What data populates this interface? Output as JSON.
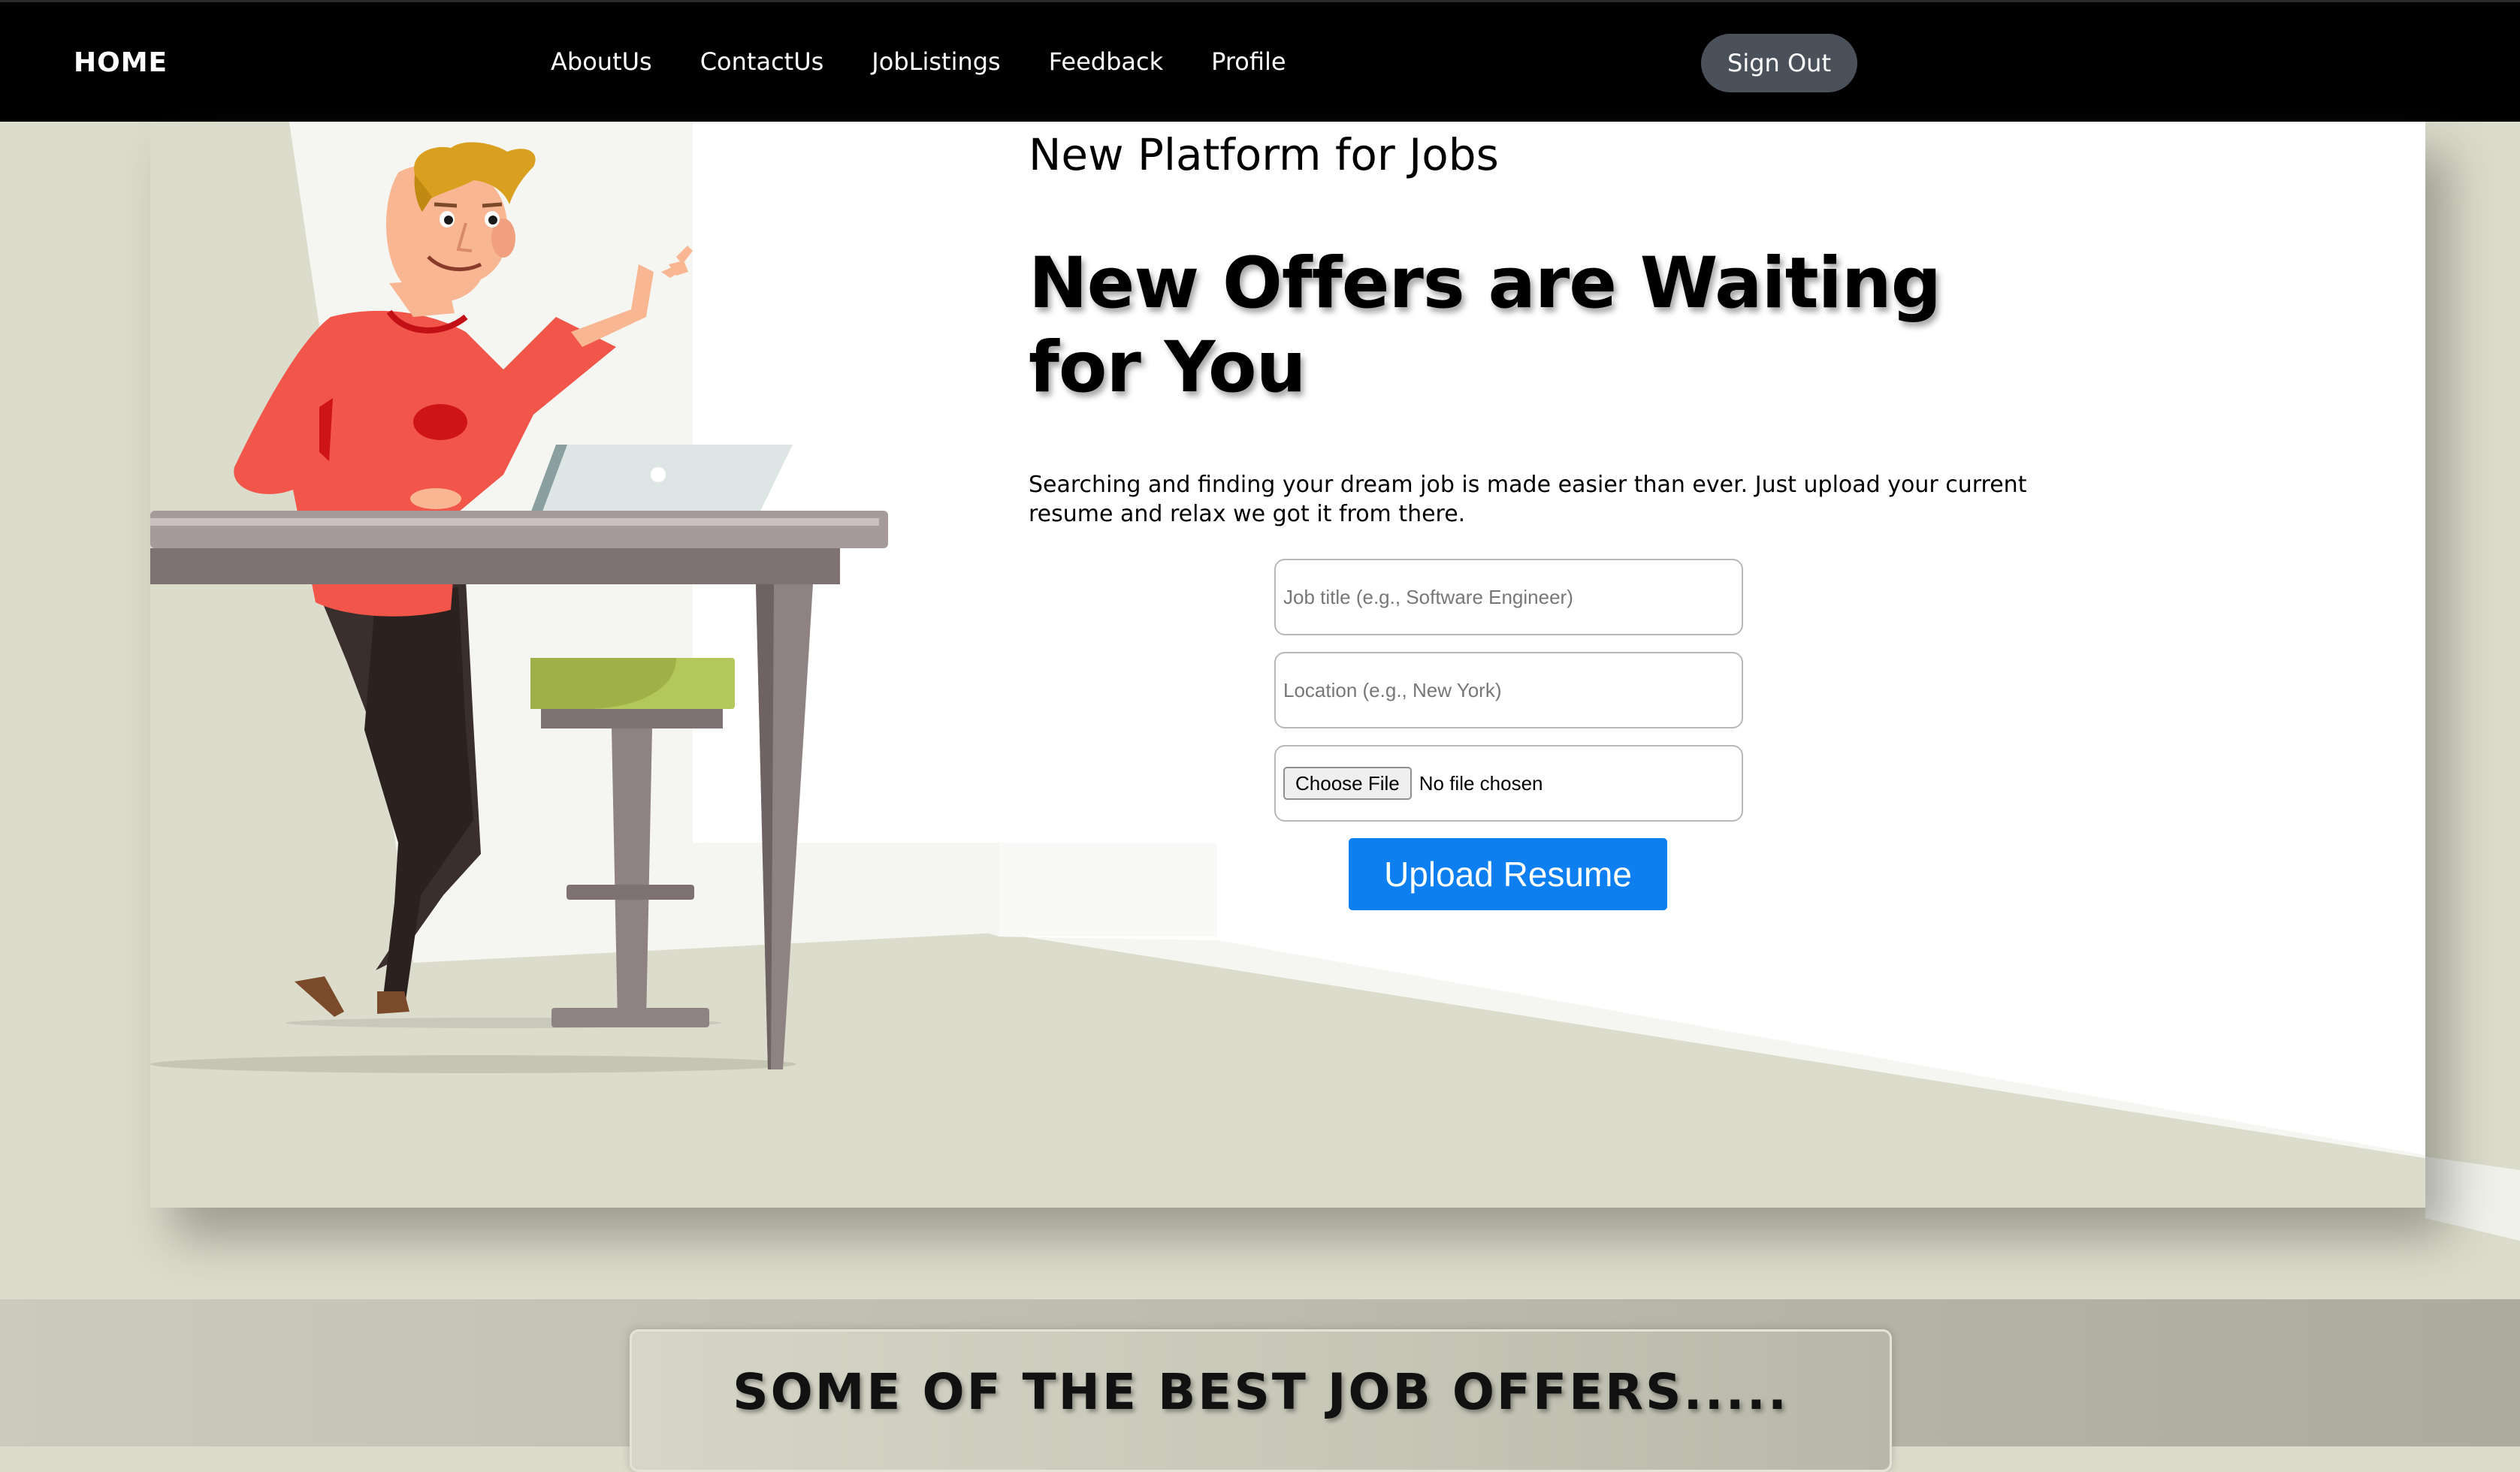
{
  "navbar": {
    "brand": "HOME",
    "links": [
      "AboutUs",
      "ContactUs",
      "JobListings",
      "Feedback",
      "Profile"
    ],
    "sign_out": "Sign Out"
  },
  "hero": {
    "subtitle": "New Platform for Jobs",
    "title": "New Offers are Waiting for You",
    "description": "Searching and finding your dream job is made easier than ever. Just upload your current resume and relax we got it from there.",
    "form": {
      "job_title_placeholder": "Job title (e.g., Software Engineer)",
      "location_placeholder": "Location (e.g., New York)",
      "file_button": "Choose File",
      "file_status": "No file chosen",
      "submit": "Upload Resume"
    }
  },
  "best_offers": {
    "title": "SOME OF THE BEST JOB OFFERS....."
  },
  "colors": {
    "navbar_bg": "#000000",
    "sign_out_bg": "#4a515b",
    "upload_button_bg": "#0d7ff0",
    "page_bg": "#dcdccc",
    "card_bg": "#ffffff",
    "shirt": "#f25549",
    "hair": "#d9a020",
    "stool_seat": "#b3c75a",
    "desk": "#8e8282"
  },
  "icons": [
    "person-illustration",
    "laptop-illustration",
    "desk-illustration",
    "stool-illustration"
  ]
}
